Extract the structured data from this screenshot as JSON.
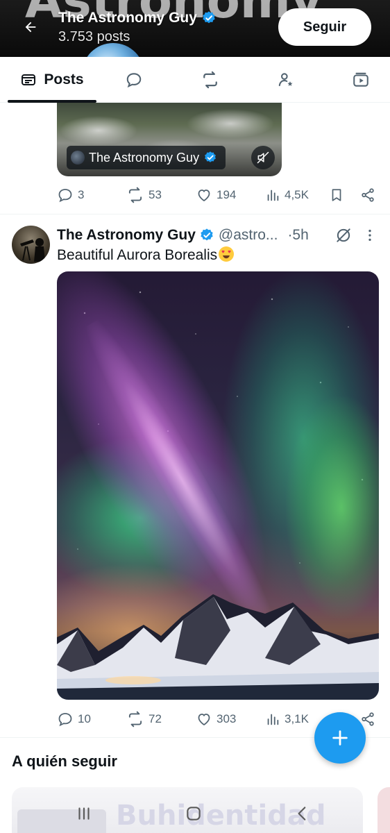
{
  "header": {
    "background_word": "Astronomy",
    "title": "The Astronomy Guy",
    "subtitle": "3.753 posts",
    "follow_label": "Seguir"
  },
  "tabs": [
    {
      "label": "Posts",
      "icon": "posts-icon",
      "active": true
    },
    {
      "label": "",
      "icon": "replies-icon",
      "active": false
    },
    {
      "label": "",
      "icon": "repost-icon",
      "active": false
    },
    {
      "label": "",
      "icon": "highlights-icon",
      "active": false
    },
    {
      "label": "",
      "icon": "media-icon",
      "active": false
    }
  ],
  "post1": {
    "media_author": "The Astronomy Guy",
    "replies": "3",
    "reposts": "53",
    "likes": "194",
    "views": "4,5K"
  },
  "post2": {
    "name": "The Astronomy Guy",
    "handle": "@astro...",
    "time": "·5h",
    "text": "Beautiful Aurora Borealis",
    "emoji": "heart-eyes-emoji",
    "replies": "10",
    "reposts": "72",
    "likes": "303",
    "views": "3,1K"
  },
  "who_to_follow": {
    "title": "A quién seguir",
    "card_banner": "Buhidentidad"
  },
  "colors": {
    "accent": "#1d9bf0",
    "verified": "#1d9bf0",
    "secondary_text": "#536471",
    "primary_text": "#0f1419"
  }
}
